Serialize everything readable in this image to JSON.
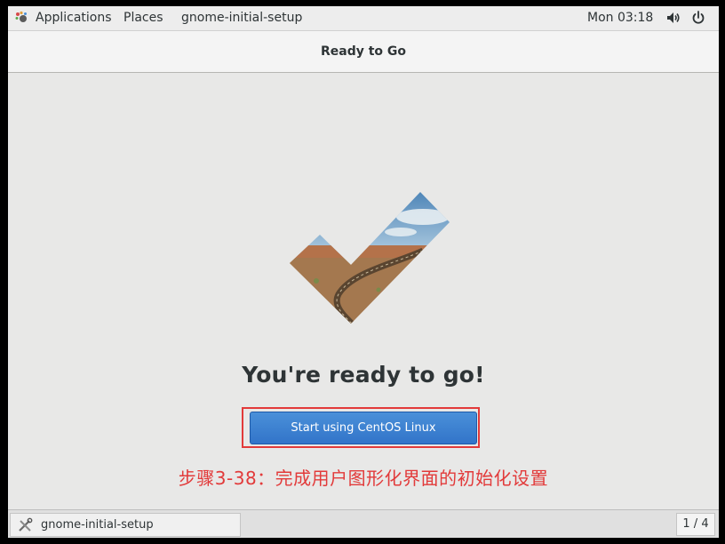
{
  "topbar": {
    "applications_label": "Applications",
    "places_label": "Places",
    "app_name": "gnome-initial-setup",
    "clock": "Mon 03:18",
    "icons": {
      "apps": "gnome-foot-icon",
      "volume": "volume-icon",
      "power": "power-icon"
    }
  },
  "header": {
    "title": "Ready to Go"
  },
  "main": {
    "headline": "You're ready to go!",
    "start_button_label": "Start using CentOS Linux",
    "annotation": "步骤3-38：完成用户图形化界面的初始化设置"
  },
  "taskbar": {
    "window_label": "gnome-initial-setup",
    "workspace": "1 / 4",
    "icons": {
      "window": "setup-tools-icon"
    }
  },
  "colors": {
    "accent": "#3b7fd0",
    "annotation_red": "#e23a3a",
    "background": "#e8e8e7"
  }
}
